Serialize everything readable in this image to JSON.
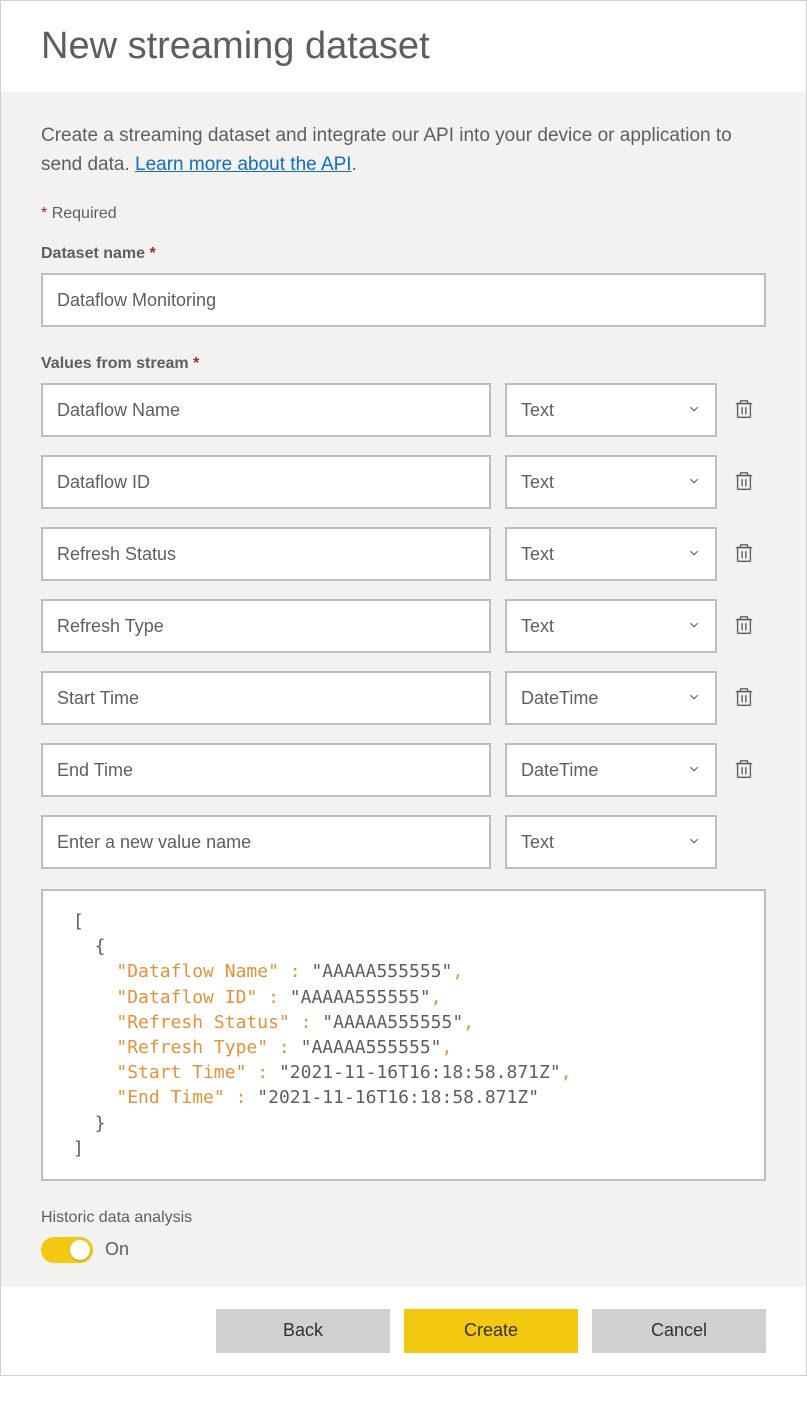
{
  "header": {
    "title": "New streaming dataset"
  },
  "description": {
    "text_before": "Create a streaming dataset and integrate our API into your device or application to send data. ",
    "link_text": "Learn more about the API",
    "text_after": "."
  },
  "required_note": "Required",
  "dataset_name": {
    "label": "Dataset name",
    "value": "Dataflow Monitoring"
  },
  "values_from_stream": {
    "label": "Values from stream",
    "rows": [
      {
        "name": "Dataflow Name",
        "type": "Text"
      },
      {
        "name": "Dataflow ID",
        "type": "Text"
      },
      {
        "name": "Refresh Status",
        "type": "Text"
      },
      {
        "name": "Refresh Type",
        "type": "Text"
      },
      {
        "name": "Start Time",
        "type": "DateTime"
      },
      {
        "name": "End Time",
        "type": "DateTime"
      }
    ],
    "new_row": {
      "placeholder": "Enter a new value name",
      "type": "Text"
    }
  },
  "json_preview": {
    "lines": [
      {
        "indent": 0,
        "raw": "["
      },
      {
        "indent": 1,
        "raw": "{"
      },
      {
        "indent": 2,
        "key": "Dataflow Name",
        "value": "AAAAA555555",
        "comma": true
      },
      {
        "indent": 2,
        "key": "Dataflow ID",
        "value": "AAAAA555555",
        "comma": true
      },
      {
        "indent": 2,
        "key": "Refresh Status",
        "value": "AAAAA555555",
        "comma": true
      },
      {
        "indent": 2,
        "key": "Refresh Type",
        "value": "AAAAA555555",
        "comma": true
      },
      {
        "indent": 2,
        "key": "Start Time",
        "value": "2021-11-16T16:18:58.871Z",
        "comma": true
      },
      {
        "indent": 2,
        "key": "End Time",
        "value": "2021-11-16T16:18:58.871Z",
        "comma": false
      },
      {
        "indent": 1,
        "raw": "}"
      },
      {
        "indent": 0,
        "raw": "]"
      }
    ]
  },
  "historic": {
    "label": "Historic data analysis",
    "state": "On"
  },
  "footer": {
    "back": "Back",
    "create": "Create",
    "cancel": "Cancel"
  }
}
